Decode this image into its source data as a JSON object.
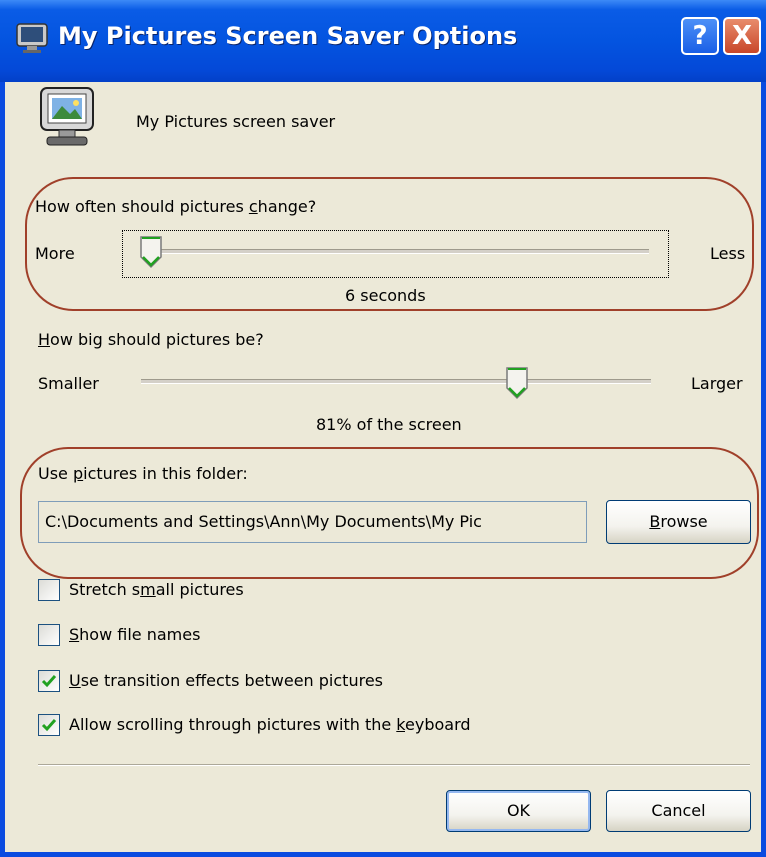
{
  "window": {
    "title": "My Pictures Screen Saver Options",
    "help_glyph": "?",
    "close_glyph": "X"
  },
  "header": {
    "caption": "My Pictures screen saver"
  },
  "change_frequency": {
    "question_before": "How often should pictures ",
    "question_access": "c",
    "question_after": "hange?",
    "min_label": "More",
    "max_label": "Less",
    "value_text": "6 seconds",
    "position_fraction": 0.02
  },
  "picture_size": {
    "question_access": "H",
    "question_after": "ow big should pictures be?",
    "min_label": "Smaller",
    "max_label": "Larger",
    "value_text": "81% of the screen",
    "position_fraction": 0.73
  },
  "folder": {
    "label_before": "Use ",
    "label_access": "p",
    "label_after": "ictures in this folder:",
    "path_value": "C:\\Documents and Settings\\Ann\\My Documents\\My Pic",
    "browse_access": "B",
    "browse_after": "rowse"
  },
  "options": [
    {
      "before": "Stretch s",
      "access": "m",
      "after": "all pictures",
      "checked": false
    },
    {
      "before": "",
      "access": "S",
      "after": "how file names",
      "checked": false
    },
    {
      "before": "",
      "access": "U",
      "after": "se transition effects between pictures",
      "checked": true
    },
    {
      "before": "Allow scrolling through pictures with the ",
      "access": "k",
      "after": "eyboard",
      "checked": true
    }
  ],
  "buttons": {
    "ok": "OK",
    "cancel": "Cancel"
  },
  "colors": {
    "titlebar": "#0454e0",
    "dialog_bg": "#ece9d8",
    "highlight_ring": "#a0402a",
    "checkmark": "#21a121"
  }
}
